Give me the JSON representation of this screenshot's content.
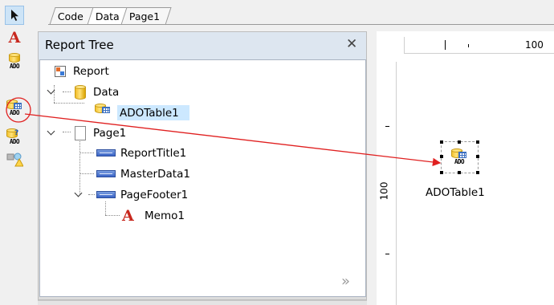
{
  "tabs": [
    {
      "label": "Code",
      "active": false
    },
    {
      "label": "Data",
      "active": true
    },
    {
      "label": "Page1",
      "active": false
    }
  ],
  "toolbar": {
    "tools": [
      {
        "name": "select",
        "icon": "arrow-pointer-icon",
        "selected": true
      },
      {
        "name": "text",
        "icon": "letter-a-icon",
        "glyph": "A"
      },
      {
        "name": "ado-database",
        "icon": "ado-database-icon",
        "label": "ADO"
      },
      {
        "name": "ado-table",
        "icon": "ado-table-icon",
        "label": "ADO",
        "highlighted": true
      },
      {
        "name": "ado-query",
        "icon": "ado-query-icon",
        "label": "ADO",
        "glyph": "?"
      },
      {
        "name": "shapes",
        "icon": "shapes-icon"
      }
    ]
  },
  "report_tree": {
    "title": "Report Tree",
    "close_glyph": "✕",
    "more_glyph": "»",
    "nodes": [
      {
        "label": "Report",
        "icon": "report-icon"
      },
      {
        "label": "Data",
        "icon": "database-icon",
        "expanded": true
      },
      {
        "label": "ADOTable1",
        "icon": "ado-table-icon",
        "selected": true
      },
      {
        "label": "Page1",
        "icon": "page-icon",
        "expanded": true
      },
      {
        "label": "ReportTitle1",
        "icon": "band-icon"
      },
      {
        "label": "MasterData1",
        "icon": "band-icon"
      },
      {
        "label": "PageFooter1",
        "icon": "band-icon",
        "expanded": true
      },
      {
        "label": "Memo1",
        "icon": "memo-icon",
        "glyph": "A"
      }
    ]
  },
  "ruler": {
    "top_label": "100",
    "left_label": "100"
  },
  "canvas": {
    "component": {
      "label": "ADOTable1",
      "icon_text": "ADO"
    }
  },
  "colors": {
    "drag_arrow": "#e02020",
    "highlight_circle": "#e02020",
    "selection": "#cce8ff",
    "panel_header": "#dde6f0"
  }
}
